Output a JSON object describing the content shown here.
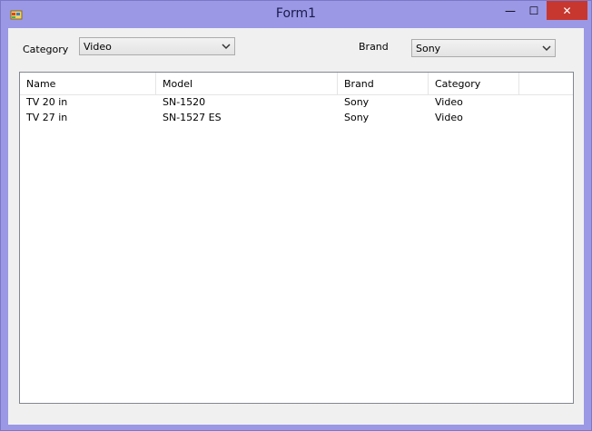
{
  "window": {
    "title": "Form1",
    "controls": {
      "minimize": "—",
      "maximize": "☐",
      "close": "✕"
    }
  },
  "filters": {
    "category_label": "Category",
    "category_value": "Video",
    "brand_label": "Brand",
    "brand_value": "Sony"
  },
  "table": {
    "columns": [
      "Name",
      "Model",
      "Brand",
      "Category"
    ],
    "rows": [
      [
        "TV 20 in",
        "SN-1520",
        "Sony",
        "Video"
      ],
      [
        "TV 27 in",
        "SN-1527 ES",
        "Sony",
        "Video"
      ]
    ]
  }
}
